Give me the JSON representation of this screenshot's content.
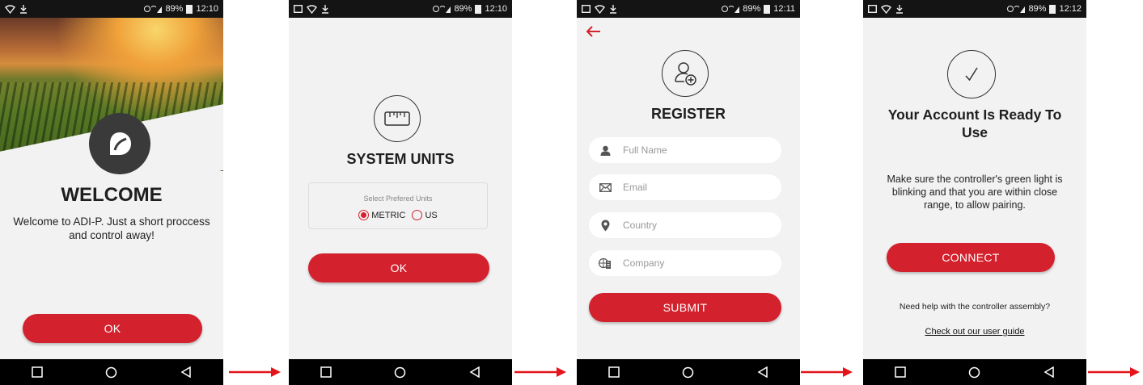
{
  "colors": {
    "accent": "#d3212d",
    "background": "#f2f2f2",
    "statusbar": "#141414"
  },
  "screens": {
    "welcome": {
      "status_time": "12:10",
      "status_battery": "89%",
      "title": "WELCOME",
      "description": "Welcome to ADI-P. Just a short proccess and control away!",
      "ok_label": "OK"
    },
    "units": {
      "status_time": "12:10",
      "status_battery": "89%",
      "title": "SYSTEM UNITS",
      "select_label": "Select Prefered Units",
      "options": [
        "METRIC",
        "US"
      ],
      "selected": "METRIC",
      "ok_label": "OK"
    },
    "register": {
      "status_time": "12:11",
      "status_battery": "89%",
      "title": "REGISTER",
      "fields": {
        "full_name": "Full Name",
        "email": "Email",
        "country": "Country",
        "company": "Company"
      },
      "submit_label": "SUBMIT"
    },
    "ready": {
      "status_time": "12:12",
      "status_battery": "89%",
      "title_line1": "Your Account Is Ready To",
      "title_line2": "Use",
      "message_line1": "Make sure the controller's green light is",
      "message_line2": "blinking and that you are within close",
      "message_line3": "range, to allow pairing.",
      "connect_label": "CONNECT",
      "help_text": "Need help with the controller assembly?",
      "guide_link": "Check out our user guide"
    }
  },
  "icons": [
    "wifi-icon",
    "download-icon",
    "signal-icon",
    "battery-icon",
    "leaf-logo-icon",
    "ruler-icon",
    "add-user-icon",
    "user-icon",
    "mail-icon",
    "location-pin-icon",
    "building-icon",
    "checkmark-icon",
    "back-arrow-icon",
    "nav-square-icon",
    "nav-circle-icon",
    "nav-back-icon",
    "flow-arrow-icon"
  ]
}
